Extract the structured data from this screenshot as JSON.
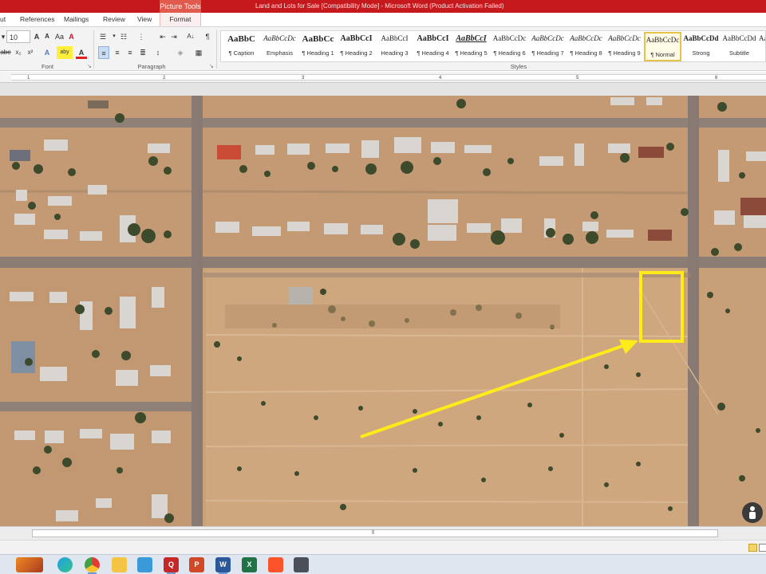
{
  "window": {
    "title": "Land and Lots for Sale [Compatibility Mode] - Microsoft Word (Product Activation Failed)",
    "context_group": "Picture Tools"
  },
  "tabs": [
    "ut",
    "References",
    "Mailings",
    "Review",
    "View",
    "Format"
  ],
  "ribbon": {
    "font": {
      "size": "10",
      "grow": "A",
      "shrink": "A",
      "case": "Aa",
      "clear": "A",
      "strike": "abe",
      "subscript": "x₂",
      "superscript": "x²",
      "effects": "A",
      "highlight": "aby",
      "color": "A",
      "group_label": "Font"
    },
    "paragraph": {
      "sort": "A↓",
      "pilcrow": "¶",
      "group_label": "Paragraph"
    },
    "styles": {
      "group_label": "Styles",
      "items": [
        {
          "sample": "AaBbC",
          "name": "¶ Caption"
        },
        {
          "sample": "AaBbCcDc",
          "name": "Emphasis"
        },
        {
          "sample": "AaBbCc",
          "name": "¶ Heading 1"
        },
        {
          "sample": "AaBbCcI",
          "name": "¶ Heading 2"
        },
        {
          "sample": "AaBbCcI",
          "name": "Heading 3"
        },
        {
          "sample": "AaBbCcI",
          "name": "¶ Heading 4"
        },
        {
          "sample": "AaBbCcI",
          "name": "¶ Heading 5"
        },
        {
          "sample": "AaBbCcDc",
          "name": "¶ Heading 6"
        },
        {
          "sample": "AaBbCcDc",
          "name": "¶ Heading 7"
        },
        {
          "sample": "AaBbCcDc",
          "name": "¶ Heading 8"
        },
        {
          "sample": "AaBbCcDc",
          "name": "¶ Heading 9"
        },
        {
          "sample": "AaBbCcDc",
          "name": "¶ Normal"
        },
        {
          "sample": "AaBbCcDd",
          "name": "Strong"
        },
        {
          "sample": "AaBbCcDd",
          "name": "Subtitle"
        },
        {
          "sample": "Aa",
          "name": ""
        }
      ],
      "active": "¶ Normal"
    }
  },
  "ruler": {
    "ticks": [
      "1",
      "2",
      "3",
      "4",
      "5",
      "6"
    ]
  },
  "image": {
    "description_shown": "satellite view of desert lots",
    "highlight_color": "#ffeb1a",
    "arrow_color": "#ffeb1a"
  },
  "taskbar": {
    "apps": [
      "firefox",
      "edge",
      "chrome",
      "files",
      "store",
      "quickbooks",
      "powerpoint",
      "word",
      "excel",
      "brave",
      "remote"
    ]
  },
  "colors": {
    "titlebar": "#c5191e",
    "context_tab": "#e05a4e",
    "ribbon": "#f3f3f3",
    "selected_style_border": "#e6c449"
  }
}
